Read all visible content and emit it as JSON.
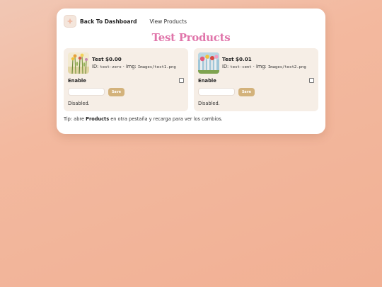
{
  "nav": {
    "back_label": "Back To Dashboard",
    "view_label": "View Products",
    "icon": "sparkle-icon"
  },
  "page": {
    "title": "Test Products"
  },
  "products": [
    {
      "name": "Test $0.00",
      "id_label": "ID:",
      "id": "test-zero",
      "img_label": "· Img:",
      "img": "Images/test1.png",
      "enable_label": "Enable",
      "enabled": false,
      "price_value": "",
      "save_label": "Save",
      "status": "Disabled."
    },
    {
      "name": "Test $0.01",
      "id_label": "ID:",
      "id": "test-cent",
      "img_label": "· Img:",
      "img": "Images/test2.png",
      "enable_label": "Enable",
      "enabled": false,
      "price_value": "",
      "save_label": "Save",
      "status": "Disabled."
    }
  ],
  "tip": {
    "prefix": "Tip: abre ",
    "bold": "Products",
    "suffix": " en otra pestaña y recarga para ver los cambios."
  },
  "colors": {
    "title": "#e075aa",
    "save_button": "#d3b27b",
    "card_bg": "#f6eee6",
    "page_bg": "#f3b99f"
  }
}
